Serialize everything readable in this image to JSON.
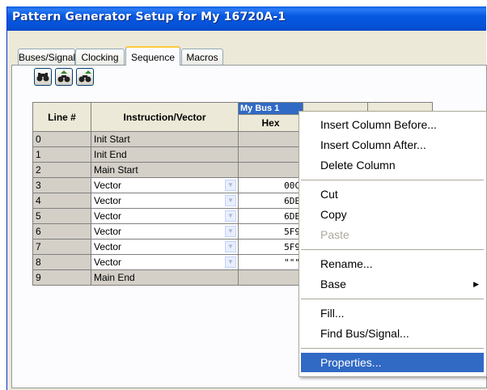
{
  "window": {
    "title": "Pattern Generator Setup for My 16720A-1"
  },
  "tabs": [
    {
      "label": "Buses/Signals",
      "active": false
    },
    {
      "label": "Clocking",
      "active": false
    },
    {
      "label": "Sequence",
      "active": true
    },
    {
      "label": "Macros",
      "active": false
    }
  ],
  "toolbar": [
    {
      "icon": "find-icon"
    },
    {
      "icon": "find-previous-icon"
    },
    {
      "icon": "find-next-icon"
    }
  ],
  "grid": {
    "col_line": "Line #",
    "col_instruction": "Instruction/Vector",
    "bus_name": "My Bus 1",
    "bus_format": "Hex",
    "rows": [
      {
        "line": "0",
        "instruction": "Init Start",
        "type": "label",
        "hex": ""
      },
      {
        "line": "1",
        "instruction": "Init End",
        "type": "label",
        "hex": ""
      },
      {
        "line": "2",
        "instruction": "Main Start",
        "type": "label",
        "hex": ""
      },
      {
        "line": "3",
        "instruction": "Vector",
        "type": "vector",
        "hex": "00C"
      },
      {
        "line": "4",
        "instruction": "Vector",
        "type": "vector",
        "hex": "6DE"
      },
      {
        "line": "5",
        "instruction": "Vector",
        "type": "vector",
        "hex": "6DE"
      },
      {
        "line": "6",
        "instruction": "Vector",
        "type": "vector",
        "hex": "5F9"
      },
      {
        "line": "7",
        "instruction": "Vector",
        "type": "vector",
        "hex": "5F9"
      },
      {
        "line": "8",
        "instruction": "Vector",
        "type": "vector",
        "hex": "\"\"\""
      },
      {
        "line": "9",
        "instruction": "Main End",
        "type": "label",
        "hex": ""
      }
    ]
  },
  "context_menu": {
    "items": [
      {
        "label": "Insert Column Before...",
        "enabled": true
      },
      {
        "label": "Insert Column After...",
        "enabled": true
      },
      {
        "label": "Delete Column",
        "enabled": true
      },
      {
        "separator": true
      },
      {
        "label": "Cut",
        "enabled": true
      },
      {
        "label": "Copy",
        "enabled": true
      },
      {
        "label": "Paste",
        "enabled": false
      },
      {
        "separator": true
      },
      {
        "label": "Rename...",
        "enabled": true
      },
      {
        "label": "Base",
        "enabled": true,
        "submenu": true
      },
      {
        "separator": true
      },
      {
        "label": "Fill...",
        "enabled": true
      },
      {
        "label": "Find Bus/Signal...",
        "enabled": true
      },
      {
        "separator": true
      },
      {
        "label": "Properties...",
        "enabled": true,
        "highlighted": true
      }
    ]
  },
  "colors": {
    "title_bar": "#0758e0",
    "selection": "#316ac5",
    "tab_highlight": "#ffc83c"
  }
}
